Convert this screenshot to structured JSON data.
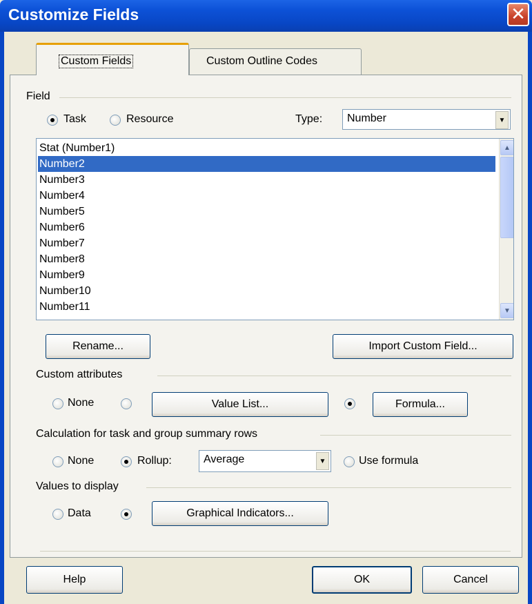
{
  "window": {
    "title": "Customize Fields",
    "close_glyph": "✕"
  },
  "tabs": [
    {
      "label": "Custom Fields",
      "active": true
    },
    {
      "label": "Custom Outline Codes",
      "active": false
    }
  ],
  "field_group": {
    "heading": "Field",
    "task_label": "Task",
    "resource_label": "Resource",
    "selected_scope": "Task",
    "type_label": "Type:",
    "type_value": "Number"
  },
  "field_list": {
    "items": [
      "Stat (Number1)",
      "Number2",
      "Number3",
      "Number4",
      "Number5",
      "Number6",
      "Number7",
      "Number8",
      "Number9",
      "Number10",
      "Number11"
    ],
    "selected": "Number2"
  },
  "buttons": {
    "rename": "Rename...",
    "import": "Import Custom Field...",
    "value_list": "Value List...",
    "formula": "Formula...",
    "graphical_indicators": "Graphical Indicators...",
    "help": "Help",
    "ok": "OK",
    "cancel": "Cancel"
  },
  "custom_attributes": {
    "heading": "Custom attributes",
    "none_label": "None",
    "selected": "Formula"
  },
  "calculation": {
    "heading": "Calculation for task and group summary rows",
    "none_label": "None",
    "rollup_label": "Rollup:",
    "rollup_value": "Average",
    "use_formula_label": "Use formula",
    "selected": "Rollup"
  },
  "values_display": {
    "heading": "Values to display",
    "data_label": "Data",
    "selected": "Graphical Indicators"
  },
  "icons": {
    "scroll_up": "▲",
    "scroll_down": "▼",
    "dropdown": "▼"
  },
  "colors": {
    "selection": "#316ac5",
    "titlebar": "#0846c4",
    "dialog_bg": "#ece9d8"
  }
}
